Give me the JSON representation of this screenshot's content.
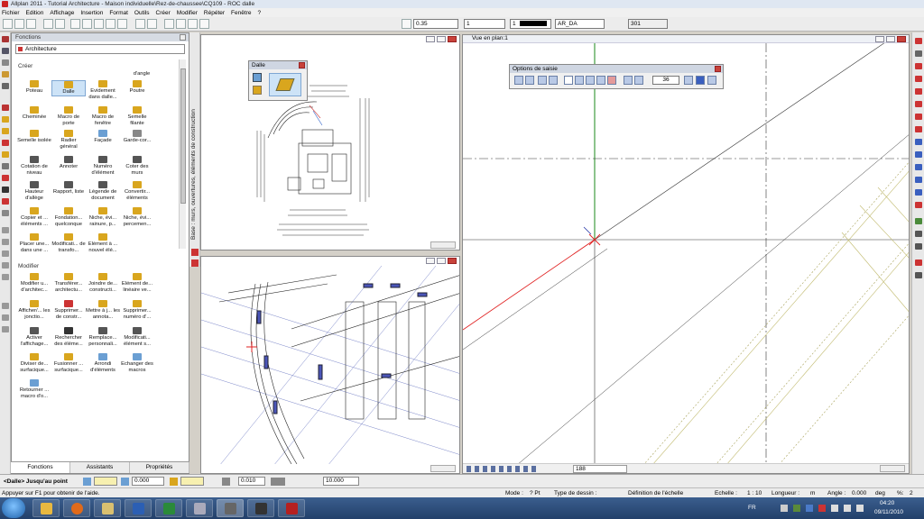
{
  "title_bar": {
    "text": "Allplan 2011 - Tutorial Architecture - Maison individuelle\\Rez-de-chaussee\\CQ109 - ROC dalle"
  },
  "menu": [
    "Fichier",
    "Edition",
    "Affichage",
    "Insertion",
    "Format",
    "Outils",
    "Créer",
    "Modifier",
    "Répéter",
    "Fenêtre",
    "?"
  ],
  "toolbar": {
    "pen_value": "0.35",
    "line_value": "1",
    "color_value": "1",
    "layer_value": "AR_DA",
    "pattern_value": "301"
  },
  "functions_panel": {
    "title": "Fonctions",
    "module": "Architecture",
    "section_create": "Créer",
    "section_modify": "Modifier",
    "create_items": [
      "Poteau",
      "Dalle",
      "Evidement dans dalle...",
      "Poutre",
      "d'angle",
      "Cheminée",
      "Macro de porte",
      "Macro de fenêtre",
      "Semelle filante",
      "Semelle isolée",
      "Radier général",
      "Façade",
      "Garde-cor...",
      "Cotation de niveau",
      "Annoter",
      "Numéro d'élément",
      "Coter des murs",
      "Hauteur d'allège",
      "Rapport, liste",
      "Légende de document",
      "Convertir... éléments",
      "Copier et ... éléments ...",
      "Fondation... quelconque",
      "Niche, évi... rainure, p...",
      "Niche, évi... percemen...",
      "Placer une... dans une ...",
      "Modificati... de transfo...",
      "Elément à ... nouvel élé..."
    ],
    "modify_items": [
      "Modifier u... d'architec...",
      "Transférer... architectu...",
      "Joindre de... constructi...",
      "Elément de... linéaire ve...",
      "Afficher/... les jonctio...",
      "Supprimer... de constr...",
      "Mettre à j... les annota...",
      "Supprimer... numéro d'...",
      "Activer l'affichage...",
      "Rechercher des éléme...",
      "Remplace... personnali...",
      "Modificati... élément s...",
      "Diviser de... surfacique...",
      "Fusionner ... surfacique...",
      "Arrondi d'éléments",
      "Echanger des macros",
      "Retourner ... macro d'o..."
    ],
    "tabs": [
      "Fonctions",
      "Assistants",
      "Propriétés"
    ],
    "side_tab": "Base : murs, ouvertures, éléments de construction"
  },
  "dalle_palette": {
    "title": "Dalle"
  },
  "plan_window": {
    "title": "Vue en plan:1"
  },
  "options_palette": {
    "title": "Options de saisie",
    "value": "36"
  },
  "plan_footer": {
    "zoom_value": "188"
  },
  "input_bar": {
    "prompt": "<Dalle> Jusqu'au point",
    "x_value": "0.000",
    "y_value": "0.000",
    "value3": "0.010",
    "value4": "10.000"
  },
  "status_bar": {
    "help": "Appuyer sur F1 pour obtenir de l'aide.",
    "mode_label": "Mode :",
    "mode_value": "? Pt",
    "drawing_type_label": "Type de dessin :",
    "scale_def": "Définition de l'échelle",
    "scale_label": "Echelle :",
    "scale_value": "1 : 10",
    "length_label": "Longueur :",
    "length_unit": "m",
    "angle_label": "Angle :",
    "angle_value": "0.000",
    "angle_unit": "deg",
    "percent_label": "%:",
    "percent_value": "2"
  },
  "taskbar": {
    "lang": "FR",
    "time": "04:20",
    "date": "09/11/2010"
  },
  "colors": {
    "red_axis": "#e02020",
    "green_axis": "#1a8a1a",
    "title_blue": "#cfd6e2"
  }
}
